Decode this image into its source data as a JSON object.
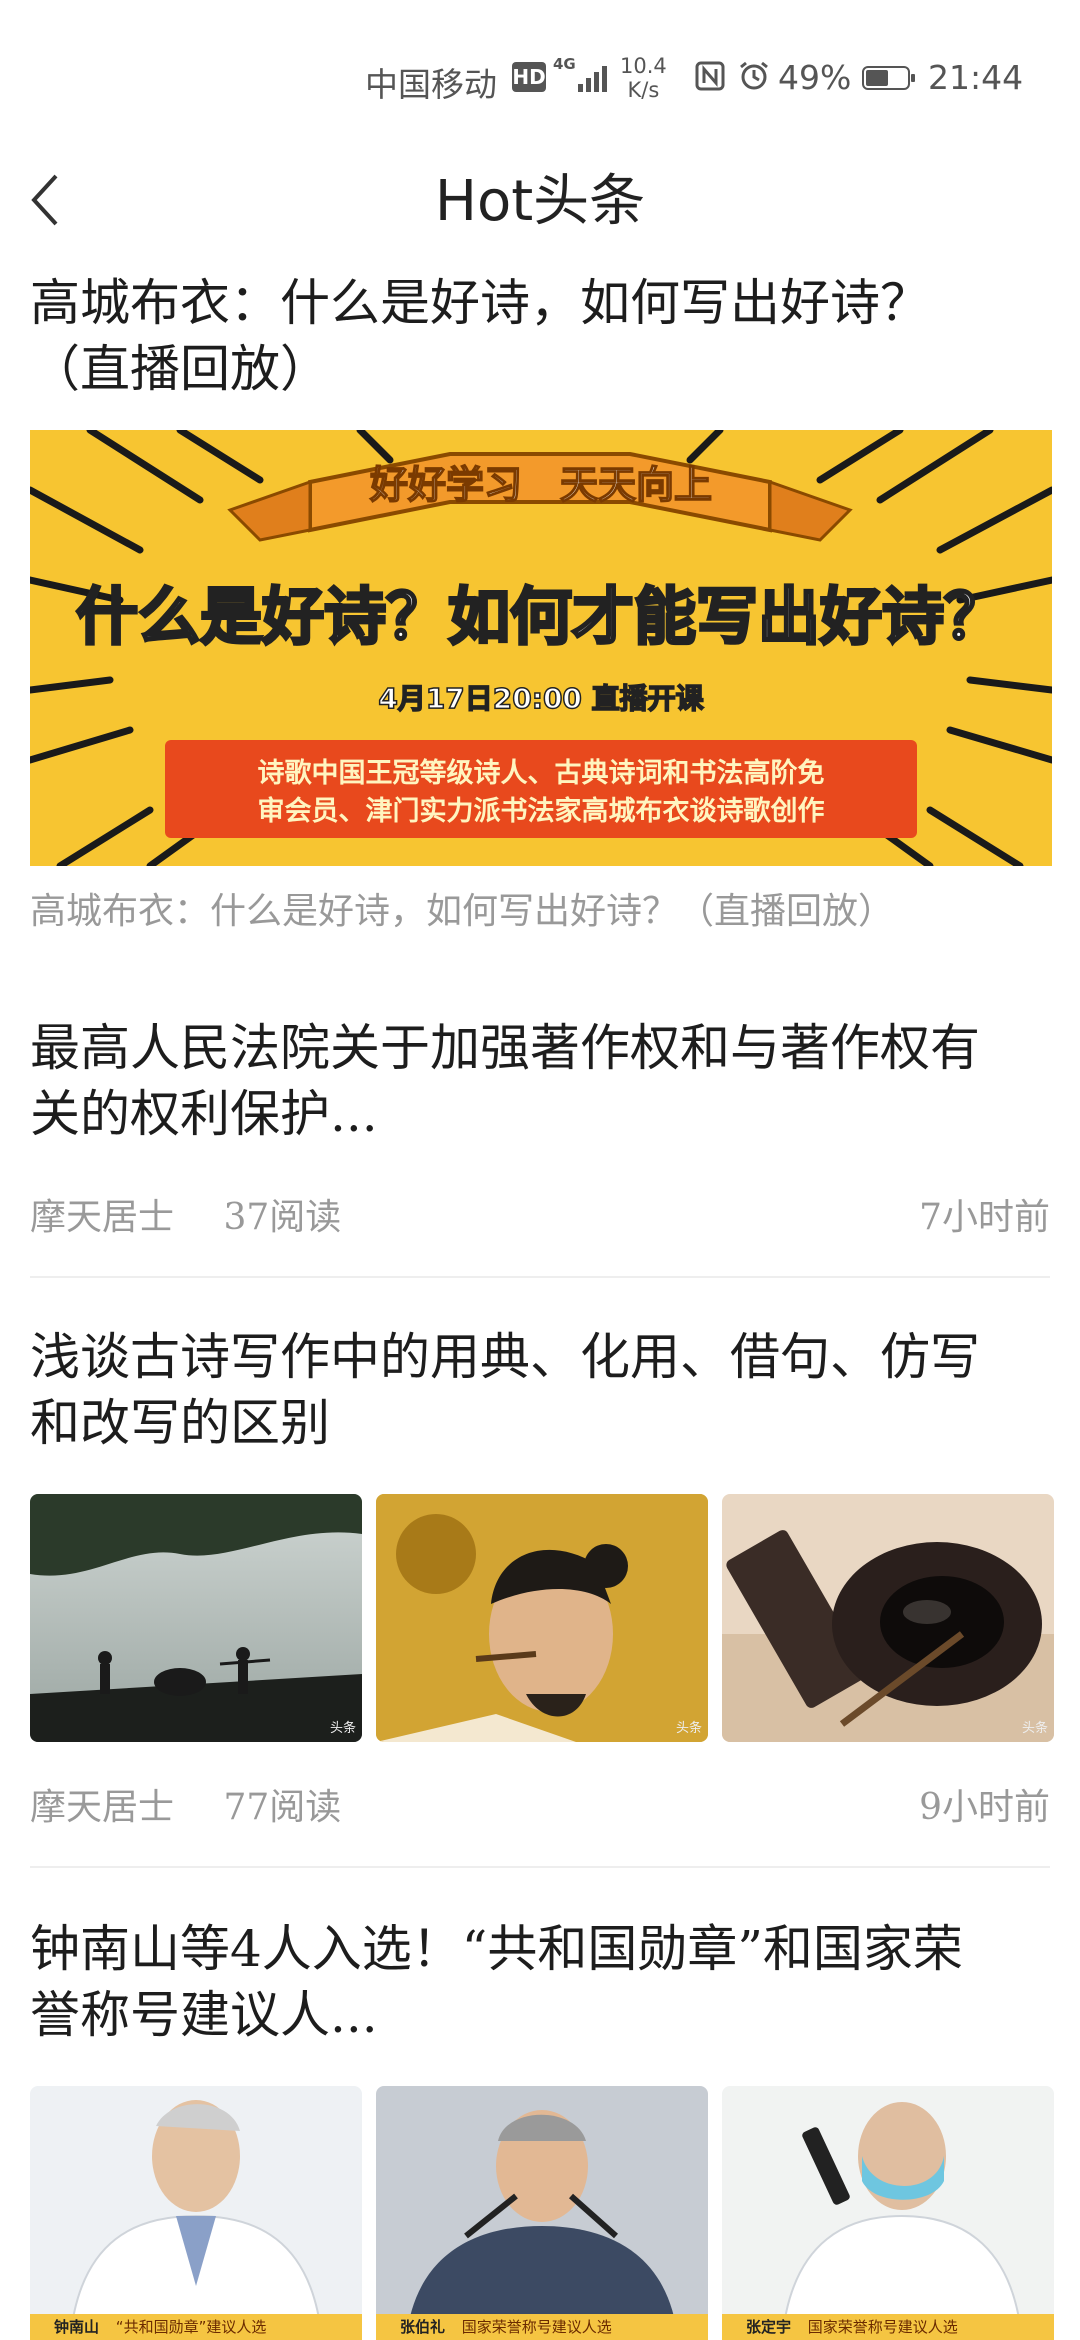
{
  "status_bar": {
    "carrier": "中国移动",
    "hd": "HD",
    "network": "4G",
    "speed_value": "10.4",
    "speed_unit": "K/s",
    "battery": "49%",
    "time": "21:44"
  },
  "header": {
    "title": "Hot头条",
    "back_icon": "chevron-left-icon"
  },
  "articles": [
    {
      "title_line1": "高城布衣：什么是好诗，如何写出好诗？",
      "title_line2": "（直播回放）",
      "banner": {
        "ribbon": "好好学习　天天向上",
        "headline": "什么是好诗？如何才能写出好诗？",
        "date": "4月17日20:00 直播开课",
        "line1": "诗歌中国王冠等级诗人、古典诗词和书法高阶免",
        "line2": "审会员、津门实力派书法家高城布衣谈诗歌创作"
      },
      "caption": "高城布衣：什么是好诗，如何写出好诗？（直播回放）"
    },
    {
      "title_line1": "最高人民法院关于加强著作权和与著作权有",
      "title_line2": "关的权利保护...",
      "author": "摩天居士",
      "reads": "37阅读",
      "time": "7小时前"
    },
    {
      "title_line1": "浅谈古诗写作中的用典、化用、借句、仿写",
      "title_line2": "和改写的区别",
      "thumb_tag": "头条",
      "author": "摩天居士",
      "reads": "77阅读",
      "time": "9小时前"
    },
    {
      "title_line1": "钟南山等4人入选！“共和国勋章”和国家荣",
      "title_line2": "誉称号建议人...",
      "plates": [
        {
          "name": "钟南山",
          "text": "“共和国勋章”建议人选"
        },
        {
          "name": "张伯礼",
          "text": "国家荣誉称号建议人选"
        },
        {
          "name": "张定宇",
          "text": "国家荣誉称号建议人选"
        }
      ]
    }
  ]
}
